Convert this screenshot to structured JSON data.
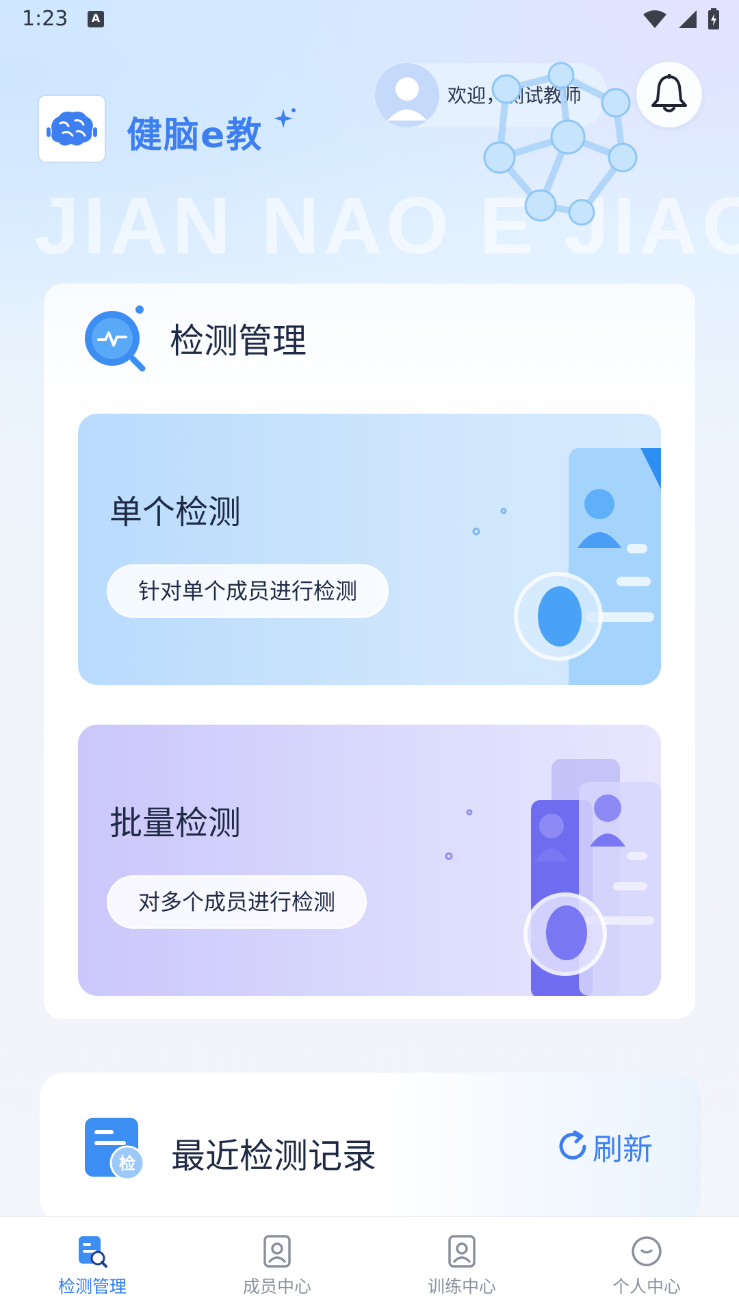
{
  "status_bar": {
    "time": "1:23",
    "indicator": "A"
  },
  "header": {
    "brand": "健脑e教",
    "watermark": "JIAN NAO E JIAO",
    "welcome": "欢迎，测试教师",
    "notification_icon": "bell-icon",
    "accent_color": "#3d7ff0"
  },
  "detect_section": {
    "title": "检测管理",
    "cards": [
      {
        "title": "单个检测",
        "description": "针对单个成员进行检测"
      },
      {
        "title": "批量检测",
        "description": "对多个成员进行检测"
      }
    ]
  },
  "recent_section": {
    "title": "最近检测记录",
    "refresh_label": "刷新",
    "badge_char": "检"
  },
  "bottom_nav": {
    "items": [
      {
        "label": "检测管理",
        "icon": "detect-doc-icon",
        "active": true
      },
      {
        "label": "成员中心",
        "icon": "member-icon",
        "active": false
      },
      {
        "label": "训练中心",
        "icon": "training-icon",
        "active": false
      },
      {
        "label": "个人中心",
        "icon": "personal-icon",
        "active": false
      }
    ],
    "active_color": "#2f7cf0",
    "inactive_color": "#8a909c"
  }
}
